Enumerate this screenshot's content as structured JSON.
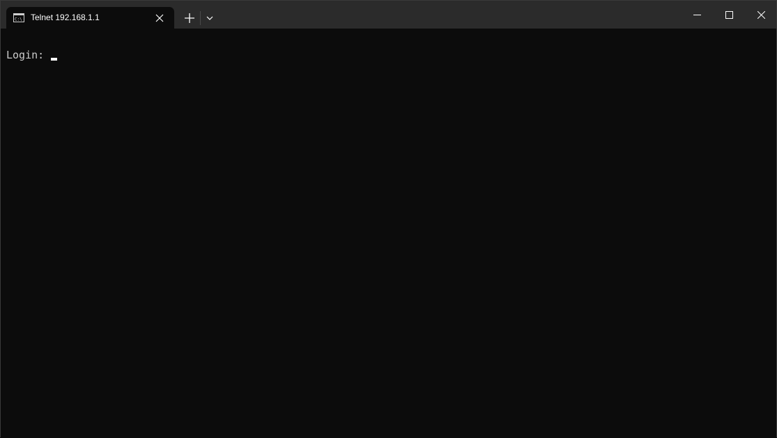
{
  "tab": {
    "title": "Telnet 192.168.1.1",
    "icon": "command-prompt-icon"
  },
  "titlebar": {
    "new_tab_icon": "plus-icon",
    "dropdown_icon": "chevron-down-icon",
    "minimize_icon": "minimize-icon",
    "maximize_icon": "maximize-icon",
    "close_icon": "close-icon"
  },
  "terminal": {
    "prompt": "Login: ",
    "input": ""
  },
  "colors": {
    "titlebar_bg": "#2b2b2b",
    "terminal_bg": "#0c0c0c",
    "terminal_fg": "#cccccc"
  }
}
